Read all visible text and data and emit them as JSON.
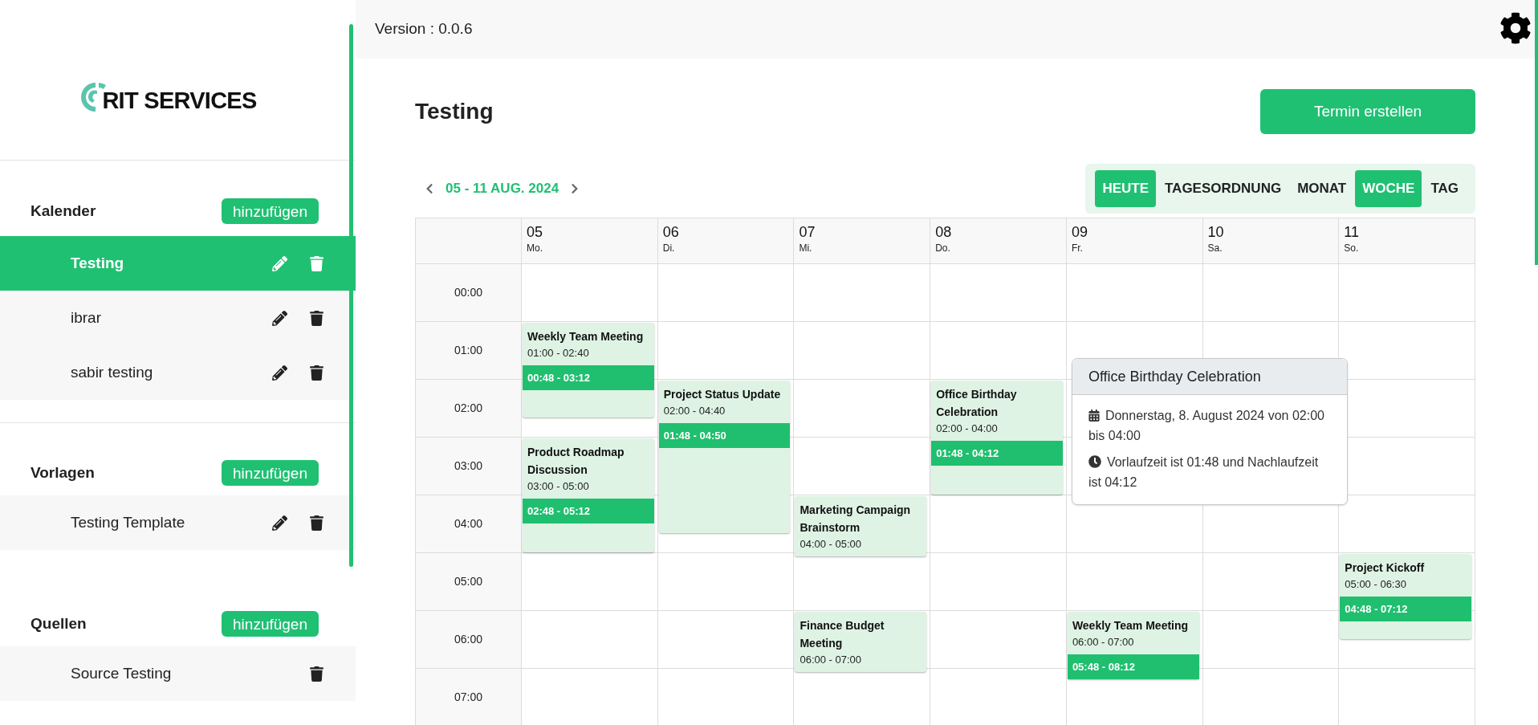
{
  "sidebar": {
    "logo": {
      "text": "RIT SERVICES"
    },
    "sections": [
      {
        "title": "Kalender",
        "add_label": "hinzufügen",
        "items": [
          {
            "label": "Testing",
            "selected": true,
            "editable": true
          },
          {
            "label": "ibrar",
            "selected": false,
            "editable": true
          },
          {
            "label": "sabir testing",
            "selected": false,
            "editable": true
          }
        ]
      },
      {
        "title": "Vorlagen",
        "add_label": "hinzufügen",
        "items": [
          {
            "label": "Testing Template",
            "selected": false,
            "editable": true
          }
        ]
      },
      {
        "title": "Quellen",
        "add_label": "hinzufügen",
        "items": [
          {
            "label": "Source Testing",
            "selected": false,
            "editable": false
          }
        ]
      }
    ]
  },
  "header": {
    "version": "Version : 0.0.6"
  },
  "page": {
    "title": "Testing",
    "create_button": "Termin erstellen"
  },
  "calendar": {
    "range": "05 - 11 AUG. 2024",
    "views": [
      {
        "label": "HEUTE",
        "selected": true
      },
      {
        "label": "TAGESORDNUNG",
        "selected": false
      },
      {
        "label": "MONAT",
        "selected": false
      },
      {
        "label": "WOCHE",
        "selected": true
      },
      {
        "label": "TAG",
        "selected": false
      }
    ],
    "hours": [
      "00:00",
      "01:00",
      "02:00",
      "03:00",
      "04:00",
      "05:00",
      "06:00",
      "07:00"
    ],
    "days": [
      {
        "date": "05",
        "weekday": "Mo.",
        "events": [
          {
            "title": "Weekly Team Meeting",
            "time": "01:00 - 02:40",
            "buffer": "00:48 - 03:12"
          },
          {
            "title": "Product Roadmap Discussion",
            "time": "03:00 - 05:00",
            "buffer": "02:48 - 05:12"
          }
        ]
      },
      {
        "date": "06",
        "weekday": "Di.",
        "events": [
          {
            "title": "Project Status Update",
            "time": "02:00 - 04:40",
            "buffer": "01:48 - 04:50"
          }
        ]
      },
      {
        "date": "07",
        "weekday": "Mi.",
        "events": [
          {
            "title": "Marketing Campaign Brainstorm",
            "time": "04:00 - 05:00"
          },
          {
            "title": "Finance Budget Meeting",
            "time": "06:00 - 07:00"
          }
        ]
      },
      {
        "date": "08",
        "weekday": "Do.",
        "events": [
          {
            "title": "Office Birthday Celebration",
            "time": "02:00 - 04:00",
            "buffer": "01:48 - 04:12",
            "popover": {
              "title": "Office Birthday Celebration",
              "date_text": "Donnerstag, 8. August 2024 von 02:00 bis 04:00",
              "buffer_text": "Vorlaufzeit ist 01:48 und Nachlaufzeit ist 04:12"
            }
          }
        ]
      },
      {
        "date": "09",
        "weekday": "Fr.",
        "events": [
          {
            "title": "Weekly Team Meeting",
            "time": "06:00 - 07:00",
            "buffer": "05:48 - 08:12"
          }
        ]
      },
      {
        "date": "10",
        "weekday": "Sa."
      },
      {
        "date": "11",
        "weekday": "So.",
        "events": [
          {
            "title": "Project Kickoff",
            "time": "05:00 - 06:30",
            "buffer": "04:48 - 07:12"
          }
        ]
      }
    ]
  }
}
